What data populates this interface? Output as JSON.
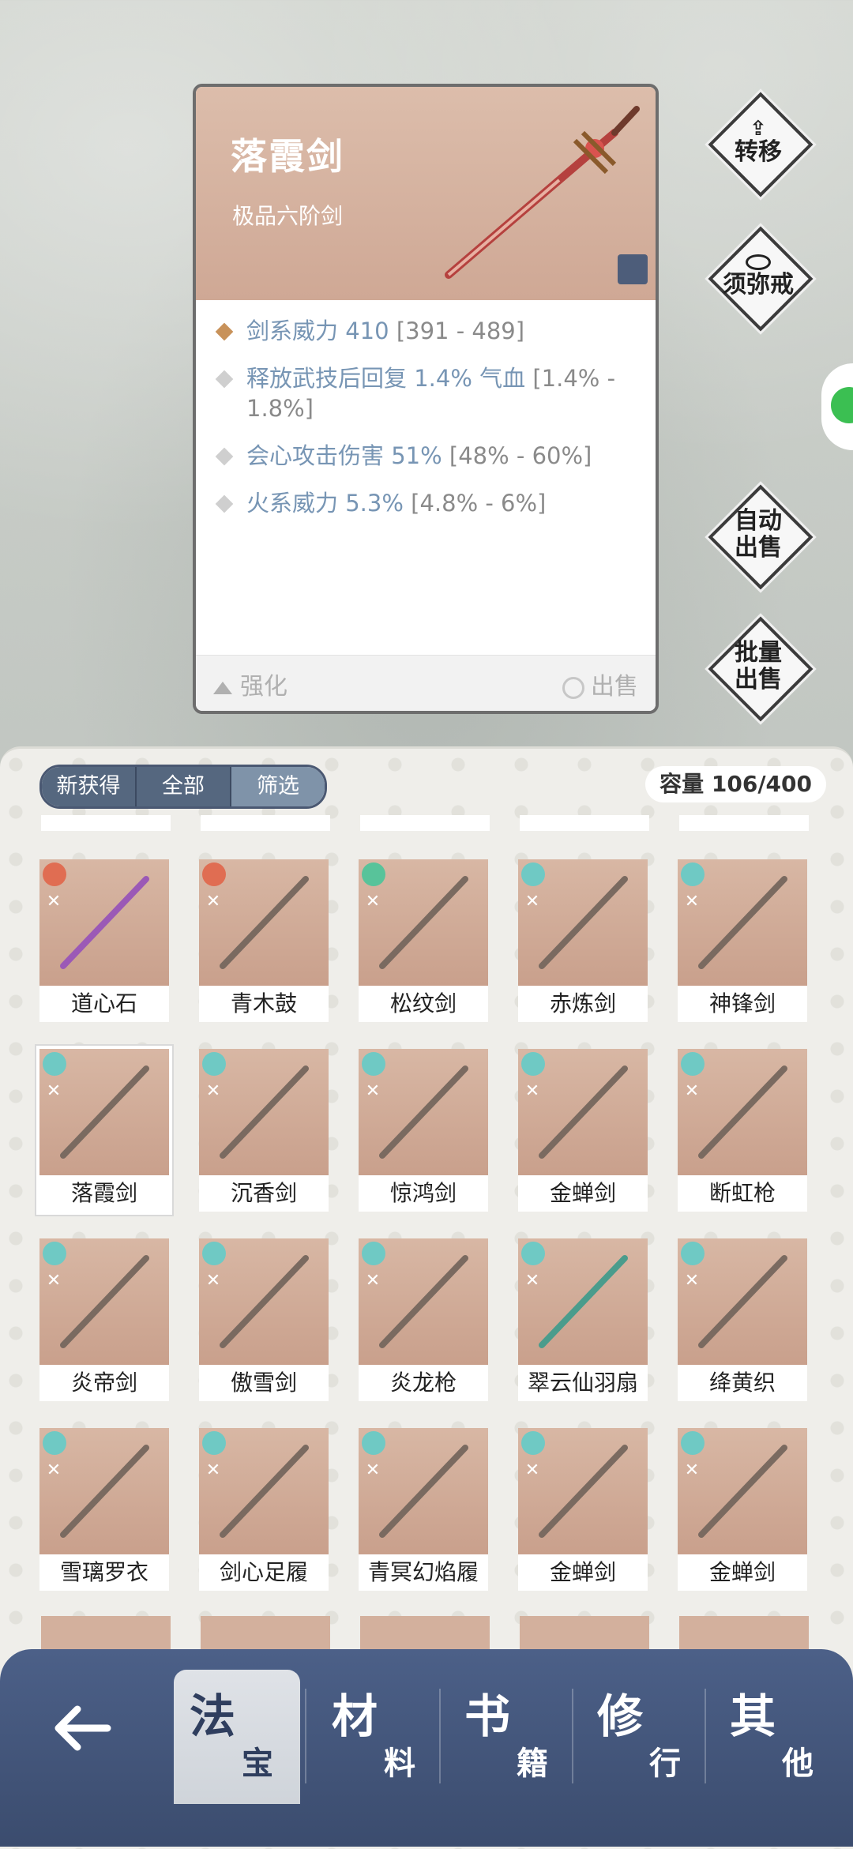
{
  "detail": {
    "title": "落霞剑",
    "subtitle": "极品六阶剑",
    "stats": [
      {
        "name": "剑系威力",
        "value": "410",
        "range": "[391 - 489]"
      },
      {
        "name": "释放武技后回复",
        "value": "1.4% 气血",
        "range": "[1.4% - 1.8%]"
      },
      {
        "name": "会心攻击伤害",
        "value": "51%",
        "range": "[48% - 60%]"
      },
      {
        "name": "火系威力",
        "value": "5.3%",
        "range": "[4.8% - 6%]"
      }
    ],
    "strengthen": "强化",
    "sell": "出售"
  },
  "side_buttons": {
    "transfer": "转移",
    "ring": "须弥戒",
    "auto_sell_1": "自动",
    "auto_sell_2": "出售",
    "batch_sell_1": "批量",
    "batch_sell_2": "出售"
  },
  "filters": [
    "新获得",
    "全部",
    "筛选"
  ],
  "capacity": "容量 106/400",
  "items": [
    {
      "name": "道心石",
      "element": "red",
      "tag": true
    },
    {
      "name": "青木鼓",
      "element": "red",
      "tag": true
    },
    {
      "name": "松纹剑",
      "element": "green",
      "tag": true
    },
    {
      "name": "赤炼剑",
      "element": "teal",
      "tag": false
    },
    {
      "name": "神锋剑",
      "element": "teal",
      "tag": false
    },
    {
      "name": "落霞剑",
      "element": "teal",
      "tag": true,
      "selected": true
    },
    {
      "name": "沉香剑",
      "element": "teal",
      "tag": false
    },
    {
      "name": "惊鸿剑",
      "element": "teal",
      "tag": false
    },
    {
      "name": "金蝉剑",
      "element": "teal",
      "tag": false
    },
    {
      "name": "断虹枪",
      "element": "teal",
      "tag": false
    },
    {
      "name": "炎帝剑",
      "element": "teal",
      "tag": false
    },
    {
      "name": "傲雪剑",
      "element": "teal",
      "tag": false
    },
    {
      "name": "炎龙枪",
      "element": "teal",
      "tag": false
    },
    {
      "name": "翠云仙羽扇",
      "element": "teal",
      "tag": true
    },
    {
      "name": "绛黄织",
      "element": "teal",
      "tag": false
    },
    {
      "name": "雪璃罗衣",
      "element": "teal",
      "tag": false
    },
    {
      "name": "剑心足履",
      "element": "teal",
      "tag": false
    },
    {
      "name": "青冥幻焰履",
      "element": "teal",
      "tag": false
    },
    {
      "name": "金蝉剑",
      "element": "teal",
      "tag": false
    },
    {
      "name": "金蝉剑",
      "element": "teal",
      "tag": false
    }
  ],
  "nav": [
    {
      "big": "法",
      "small": "宝"
    },
    {
      "big": "材",
      "small": "料"
    },
    {
      "big": "书",
      "small": "籍"
    },
    {
      "big": "修",
      "small": "行"
    },
    {
      "big": "其",
      "small": "他"
    }
  ]
}
